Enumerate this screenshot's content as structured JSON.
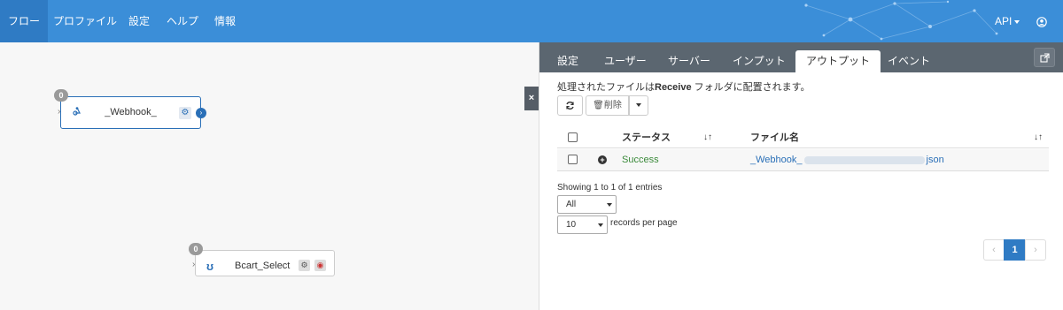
{
  "navbar": {
    "items": [
      "フロー",
      "プロファイル",
      "設定",
      "ヘルプ",
      "情報"
    ],
    "api_label": "API",
    "colors": {
      "bar": "#3b8ed8",
      "active": "#2f7bc4"
    }
  },
  "canvas": {
    "node1": {
      "badge": "0",
      "label": "_Webhook_"
    },
    "node2": {
      "badge": "0",
      "label": "Bcart_Select"
    }
  },
  "panel": {
    "tabs": [
      "設定",
      "ユーザー",
      "サーバー",
      "インプット",
      "アウトプット",
      "イベント"
    ],
    "active_tab": "アウトプット",
    "info_prefix": "処理されたファイルは",
    "info_folder": "Receive",
    "info_suffix": " フォルダに配置されます。",
    "delete_label": "削除",
    "columns": {
      "status": "ステータス",
      "filename": "ファイル名"
    },
    "rows": [
      {
        "status": "Success",
        "filename_prefix": "_Webhook_",
        "filename_suffix": "json"
      }
    ],
    "showing": "Showing 1 to 1 of 1 entries",
    "filter_select": "All",
    "page_size_select": "10",
    "records_per_page": "records per page",
    "pagination": {
      "prev": "‹",
      "current": "1",
      "next": "›"
    }
  }
}
